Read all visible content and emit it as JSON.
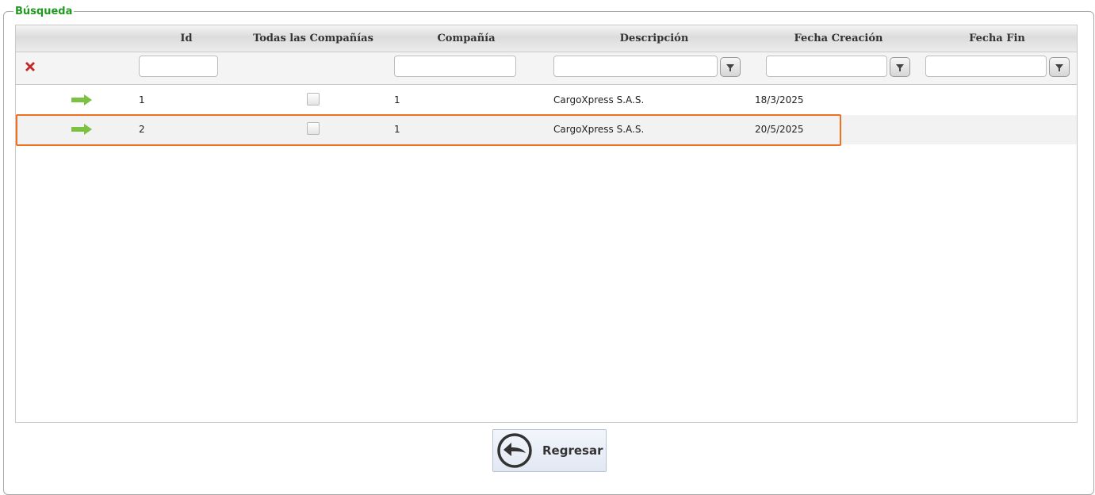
{
  "panel": {
    "legend": "Búsqueda"
  },
  "grid": {
    "columns": [
      {
        "key": "id",
        "label": "Id"
      },
      {
        "key": "todas",
        "label": "Todas las Compañías"
      },
      {
        "key": "compania",
        "label": "Compañía"
      },
      {
        "key": "descripcion",
        "label": "Descripción"
      },
      {
        "key": "fecha_creacion",
        "label": "Fecha Creación"
      },
      {
        "key": "fecha_fin",
        "label": "Fecha Fin"
      }
    ],
    "filters": {
      "id": "",
      "compania": "",
      "descripcion": "",
      "fecha_creacion": "",
      "fecha_fin": ""
    },
    "rows": [
      {
        "id": "1",
        "todas": false,
        "compania": "1",
        "descripcion": "CargoXpress S.A.S.",
        "fecha_creacion": "18/3/2025",
        "fecha_fin": ""
      },
      {
        "id": "2",
        "todas": false,
        "compania": "1",
        "descripcion": "CargoXpress S.A.S.",
        "fecha_creacion": "20/5/2025",
        "fecha_fin": ""
      }
    ]
  },
  "actions": {
    "back_label": "Regresar"
  },
  "colors": {
    "legend": "#1f9a1f",
    "highlight": "#f07020",
    "arrow": "#7cc242",
    "clear": "#c62828"
  },
  "icons": {
    "clear": "close-x-icon",
    "filter": "filter-funnel-icon",
    "select_row": "arrow-right-icon",
    "back": "back-arrow-circle-icon"
  }
}
